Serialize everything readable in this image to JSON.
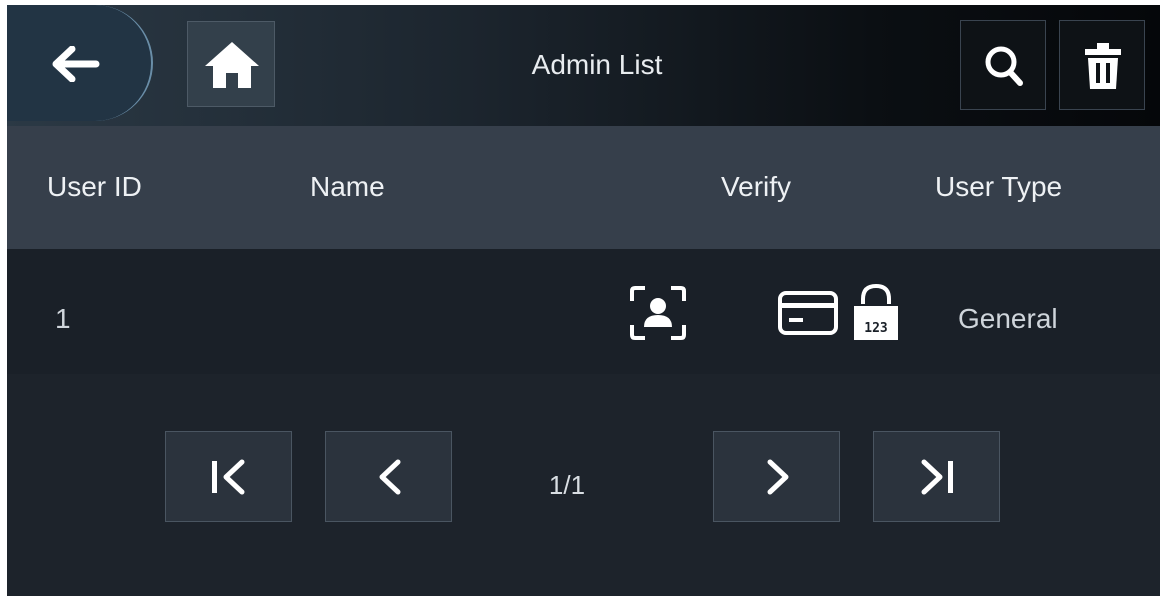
{
  "topbar": {
    "title": "Admin List",
    "back_icon": "arrow-left-icon",
    "home_icon": "home-icon",
    "search_icon": "search-icon",
    "delete_icon": "trash-icon"
  },
  "table": {
    "columns": [
      "User ID",
      "Name",
      "Verify",
      "User Type"
    ],
    "rows": [
      {
        "user_id": "1",
        "name": "",
        "verify_icons": [
          "face-icon",
          "card-icon",
          "password-icon"
        ],
        "password_digits": "123",
        "user_type": "General"
      }
    ]
  },
  "pagination": {
    "page_label": "1/1",
    "first_icon": "first-page-icon",
    "prev_icon": "chevron-left-icon",
    "next_icon": "chevron-right-icon",
    "last_icon": "last-page-icon"
  },
  "colors": {
    "background": "#1d232b",
    "header_bg": "#363f4b",
    "text": "#eef1f4"
  }
}
